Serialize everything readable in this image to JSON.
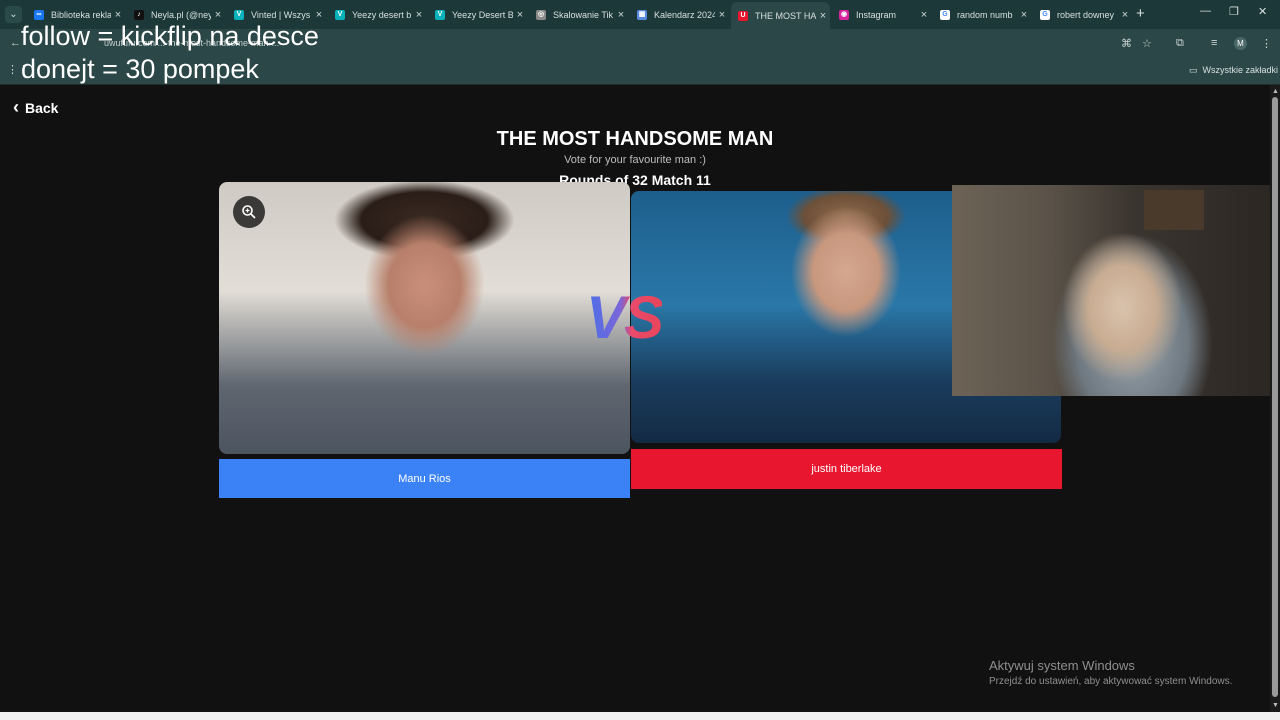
{
  "browser": {
    "tabs": [
      {
        "title": "Biblioteka rekla",
        "favicon": "meta",
        "color": "#1877f2",
        "glyph": "∞"
      },
      {
        "title": "Neyla.pl (@ney",
        "favicon": "tiktok",
        "color": "#111111",
        "glyph": "♪"
      },
      {
        "title": "Vinted | Wszys",
        "favicon": "vinted",
        "color": "#09b1ba",
        "glyph": "V"
      },
      {
        "title": "Yeezy desert b",
        "favicon": "vinted",
        "color": "#09b1ba",
        "glyph": "V"
      },
      {
        "title": "Yeezy Desert B",
        "favicon": "vinted",
        "color": "#09b1ba",
        "glyph": "V"
      },
      {
        "title": "Skalowanie Tik",
        "favicon": "globe",
        "color": "#8a8a8a",
        "glyph": "◎"
      },
      {
        "title": "Kalendarz 2024",
        "favicon": "calendar",
        "color": "#5a8adf",
        "glyph": "▦"
      },
      {
        "title": "THE MOST HAI",
        "favicon": "uwufufu",
        "color": "#e8172f",
        "glyph": "U"
      },
      {
        "title": "Instagram",
        "favicon": "instagram",
        "color": "#d6249f",
        "glyph": "◉"
      },
      {
        "title": "random numb",
        "favicon": "google",
        "color": "#ffffff",
        "glyph": "G"
      },
      {
        "title": "robert downey",
        "favicon": "google",
        "color": "#ffffff",
        "glyph": "G"
      }
    ],
    "url": "uwufufu.com/...-the-most-handsome-man-...",
    "bookmarks_all": "Wszystkie zakładki"
  },
  "overlay": {
    "line1": "follow = kickflip na desce",
    "line2": "donejt = 30 pompek"
  },
  "page": {
    "back_label": "Back",
    "title": "THE MOST HANDSOME MAN",
    "subtitle": "Vote for your favourite man :)",
    "round": "Rounds of 32 Match 11",
    "vs": "VS",
    "left_name": "Manu Rios",
    "right_name": "justin tiberlake"
  },
  "windows": {
    "activate_title": "Aktywuj system Windows",
    "activate_sub": "Przejdź do ustawień, aby aktywować system Windows."
  },
  "colors": {
    "left_button": "#3b82f6",
    "right_button": "#e8172f",
    "chrome_bg": "#1c3838"
  }
}
